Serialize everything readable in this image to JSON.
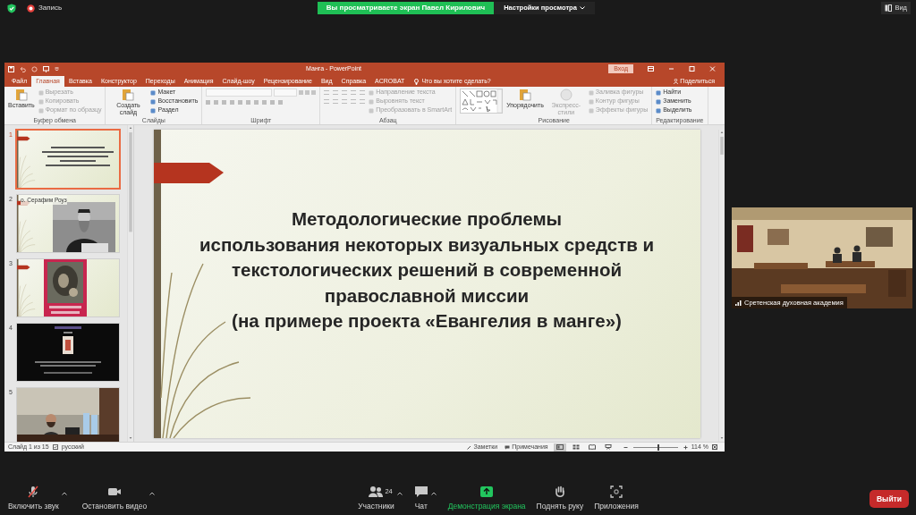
{
  "zoom_bar": {
    "recording": "Запись",
    "banner": "Вы просматриваете экран Павел Кирилович",
    "view_settings": "Настройки просмотра",
    "view": "Вид"
  },
  "powerpoint": {
    "title": "Манга - PowerPoint",
    "sign_in": "Вход",
    "tabs": [
      {
        "label": "Файл",
        "selected": false
      },
      {
        "label": "Главная",
        "selected": true
      },
      {
        "label": "Вставка",
        "selected": false
      },
      {
        "label": "Конструктор",
        "selected": false
      },
      {
        "label": "Переходы",
        "selected": false
      },
      {
        "label": "Анимация",
        "selected": false
      },
      {
        "label": "Слайд-шоу",
        "selected": false
      },
      {
        "label": "Рецензирование",
        "selected": false
      },
      {
        "label": "Вид",
        "selected": false
      },
      {
        "label": "Справка",
        "selected": false
      },
      {
        "label": "ACROBAT",
        "selected": false
      }
    ],
    "search": "Что вы хотите сделать?",
    "share": "Поделиться",
    "ribbon": [
      {
        "name": "Буфер обмена",
        "items": [
          {
            "kind": "large",
            "label": "Вставить",
            "disabled": false
          },
          {
            "kind": "small",
            "label": "Вырезать",
            "disabled": true
          },
          {
            "kind": "small",
            "label": "Копировать",
            "disabled": true
          },
          {
            "kind": "small",
            "label": "Формат по образцу",
            "disabled": true
          }
        ]
      },
      {
        "name": "Слайды",
        "items": [
          {
            "kind": "large",
            "label": "Создать слайд",
            "disabled": false
          },
          {
            "kind": "small",
            "label": "Макет",
            "disabled": false
          },
          {
            "kind": "small",
            "label": "Восстановить",
            "disabled": false
          },
          {
            "kind": "small",
            "label": "Раздел",
            "disabled": false
          }
        ]
      },
      {
        "name": "Шрифт",
        "items": [
          {
            "kind": "font-controls",
            "disabled": true
          }
        ]
      },
      {
        "name": "Абзац",
        "items": [
          {
            "kind": "paragraph-controls",
            "disabled": true
          },
          {
            "kind": "small",
            "label": "Направление текста",
            "disabled": true
          },
          {
            "kind": "small",
            "label": "Выровнять текст",
            "disabled": true
          },
          {
            "kind": "small",
            "label": "Преобразовать в SmartArt",
            "disabled": true
          }
        ]
      },
      {
        "name": "Рисование",
        "items": [
          {
            "kind": "shapes",
            "disabled": false
          },
          {
            "kind": "large",
            "label": "Упорядочить",
            "disabled": false
          },
          {
            "kind": "large",
            "label": "Экспресс-стили",
            "disabled": true
          },
          {
            "kind": "small",
            "label": "Заливка фигуры",
            "disabled": true
          },
          {
            "kind": "small",
            "label": "Контур фигуры",
            "disabled": true
          },
          {
            "kind": "small",
            "label": "Эффекты фигуры",
            "disabled": true
          }
        ]
      },
      {
        "name": "Редактирование",
        "items": [
          {
            "kind": "small",
            "label": "Найти",
            "disabled": false
          },
          {
            "kind": "small",
            "label": "Заменить",
            "disabled": false
          },
          {
            "kind": "small",
            "label": "Выделить",
            "disabled": false
          }
        ]
      }
    ],
    "slides": [
      {
        "number": "1",
        "selected": true,
        "kind": "title"
      },
      {
        "number": "2",
        "selected": false,
        "kind": "portrait",
        "caption": "о. Серафим Роуз"
      },
      {
        "number": "3",
        "selected": false,
        "kind": "icon"
      },
      {
        "number": "4",
        "selected": false,
        "kind": "dark"
      },
      {
        "number": "5",
        "selected": false
      }
    ],
    "slide_title": "Методологические проблемы\nиспользования некоторых визуальных средств и\nтекстологических решений в современной\nправославной миссии\n(на примере проекта «Евангелия в манге»)",
    "status": {
      "slide": "Слайд 1 из 15",
      "language": "русский",
      "notes": "Заметки",
      "comments": "Примечания",
      "views": [
        {
          "selected": true
        },
        {
          "selected": false
        },
        {
          "selected": false
        },
        {
          "selected": false
        }
      ],
      "zoom": {
        "level": 0.55,
        "reading": "114 %"
      }
    }
  },
  "video": {
    "name": "Сретенская духовная академия"
  },
  "toolbar": [
    {
      "kind": "mic",
      "label": "Включить звук",
      "muted": true,
      "caret": true,
      "highlighted": false
    },
    {
      "kind": "video",
      "label": "Остановить видео",
      "caret": true,
      "highlighted": false
    },
    {
      "kind": "participants",
      "label": "Участники",
      "count": "24",
      "caret": true,
      "highlighted": false
    },
    {
      "kind": "chat",
      "label": "Чат",
      "caret": true,
      "highlighted": false
    },
    {
      "kind": "share",
      "label": "Демонстрация экрана",
      "caret": false,
      "highlighted": true
    },
    {
      "kind": "hand",
      "label": "Поднять руку",
      "caret": false,
      "highlighted": false
    },
    {
      "kind": "apps",
      "label": "Приложения",
      "caret": false,
      "highlighted": false
    }
  ],
  "leave": "Выйти"
}
